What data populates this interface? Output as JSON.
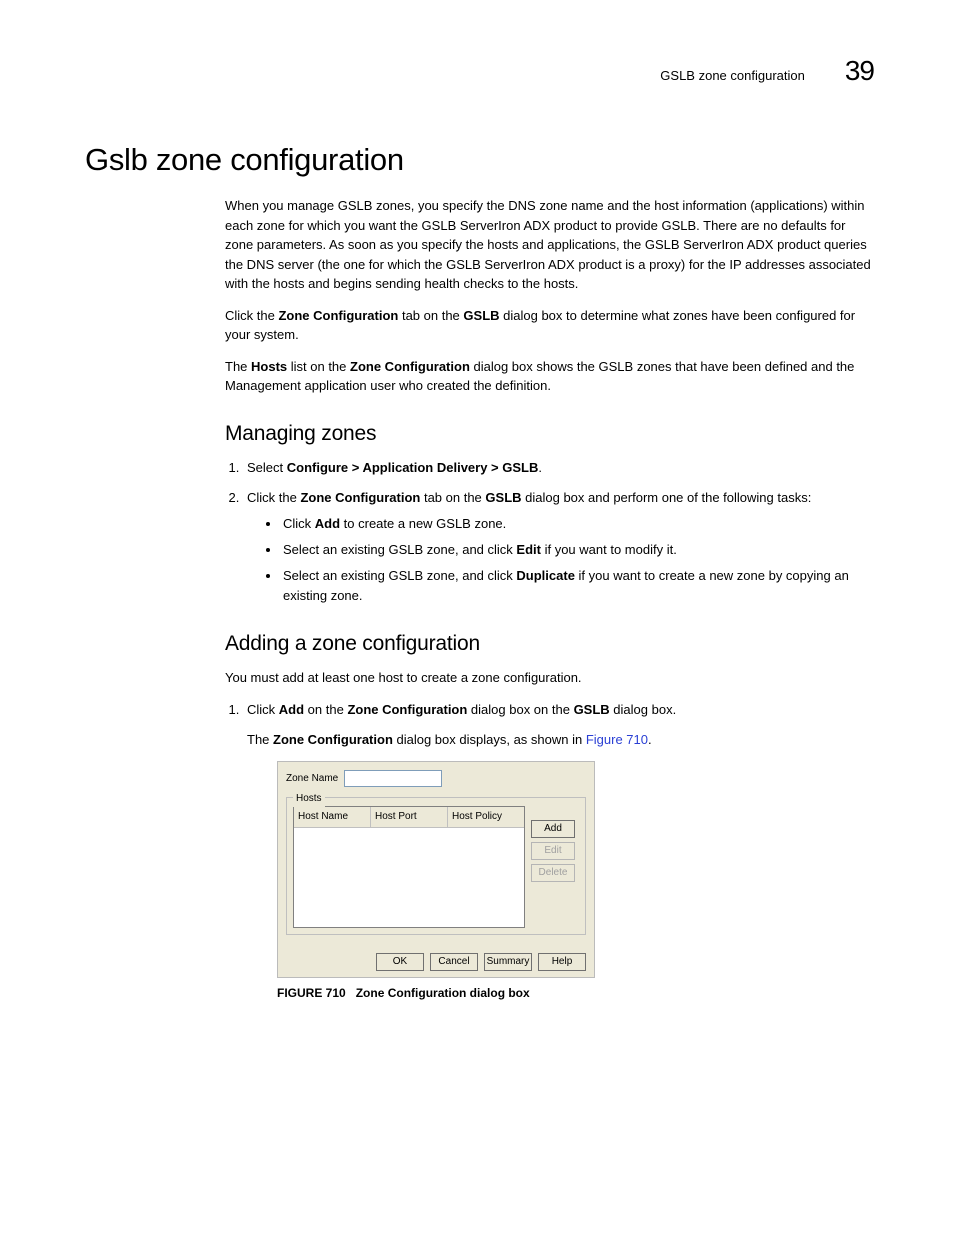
{
  "header": {
    "topic": "GSLB zone configuration",
    "chapter_number": "39"
  },
  "title": "Gslb zone configuration",
  "intro": {
    "p1": "When you manage GSLB zones, you specify the DNS zone name and the host information (applications) within each zone for which you want the GSLB ServerIron ADX product to provide GSLB. There are no defaults for zone parameters. As soon as you specify the hosts and applications, the GSLB ServerIron ADX product queries the DNS server (the one for which the GSLB ServerIron ADX product is a proxy) for the IP addresses associated with the hosts and begins sending health checks to the hosts.",
    "p2_a": "Click the ",
    "p2_b": "Zone Configuration",
    "p2_c": " tab on the ",
    "p2_d": "GSLB",
    "p2_e": " dialog box to determine what zones have been configured for your system.",
    "p3_a": "The ",
    "p3_b": "Hosts",
    "p3_c": " list on the ",
    "p3_d": "Zone Configuration",
    "p3_e": " dialog box shows the GSLB zones that have been defined and the Management application user who created the definition."
  },
  "managing": {
    "heading": "Managing zones",
    "s1_a": "Select ",
    "s1_b": "Configure > Application Delivery > GSLB",
    "s1_c": ".",
    "s2_a": "Click the ",
    "s2_b": "Zone Configuration",
    "s2_c": " tab on the ",
    "s2_d": "GSLB",
    "s2_e": " dialog box and perform one of the following tasks:",
    "b1_a": "Click ",
    "b1_b": "Add",
    "b1_c": " to create a new GSLB zone.",
    "b2_a": "Select an existing GSLB zone, and click ",
    "b2_b": "Edit",
    "b2_c": " if you want to modify it.",
    "b3_a": "Select an existing GSLB zone, and click ",
    "b3_b": "Duplicate",
    "b3_c": " if you want to create a new zone by copying an existing zone."
  },
  "adding": {
    "heading": "Adding a zone configuration",
    "p1": "You must add at least one host to create a zone configuration.",
    "s1_a": "Click ",
    "s1_b": "Add",
    "s1_c": " on the ",
    "s1_d": "Zone Configuration",
    "s1_e": " dialog box on the ",
    "s1_f": "GSLB",
    "s1_g": " dialog box.",
    "s1_p_a": "The ",
    "s1_p_b": "Zone Configuration",
    "s1_p_c": " dialog box displays, as shown in ",
    "s1_p_link": "Figure 710",
    "s1_p_d": "."
  },
  "dialog": {
    "zone_name_label": "Zone Name",
    "hosts_label": "Hosts",
    "cols": {
      "c1": "Host Name",
      "c2": "Host Port",
      "c3": "Host Policy"
    },
    "side": {
      "add": "Add",
      "edit": "Edit",
      "delete": "Delete"
    },
    "bottom": {
      "ok": "OK",
      "cancel": "Cancel",
      "summary": "Summary",
      "help": "Help"
    }
  },
  "figure": {
    "num": "FIGURE 710",
    "title": "Zone Configuration dialog box"
  }
}
